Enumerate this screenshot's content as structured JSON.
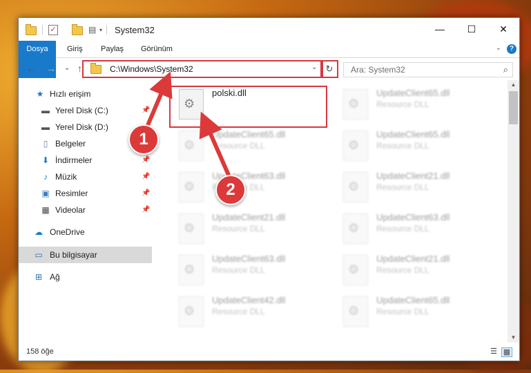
{
  "window": {
    "title": "System32",
    "controls": {
      "minimize": "—",
      "maximize": "☐",
      "close": "✕"
    }
  },
  "ribbon": {
    "tabs": [
      "Dosya",
      "Giriş",
      "Paylaş",
      "Görünüm"
    ],
    "help": "?",
    "collapse": "⌄"
  },
  "navbar": {
    "back": "←",
    "forward": "→",
    "recent": "⌄",
    "up": "↑",
    "address": "C:\\Windows\\System32",
    "refresh": "↻",
    "search_placeholder": "Ara: System32"
  },
  "sidebar": {
    "items": [
      {
        "label": "Hızlı erişim",
        "icon": "star-icon",
        "pinned": false
      },
      {
        "label": "Yerel Disk (C:)",
        "icon": "drive-icon",
        "pinned": true
      },
      {
        "label": "Yerel Disk (D:)",
        "icon": "drive-icon",
        "pinned": true
      },
      {
        "label": "Belgeler",
        "icon": "documents-icon",
        "pinned": true
      },
      {
        "label": "İndirmeler",
        "icon": "downloads-icon",
        "pinned": true
      },
      {
        "label": "Müzik",
        "icon": "music-icon",
        "pinned": true
      },
      {
        "label": "Resimler",
        "icon": "pictures-icon",
        "pinned": true
      },
      {
        "label": "Videolar",
        "icon": "videos-icon",
        "pinned": true
      },
      {
        "label": "OneDrive",
        "icon": "cloud-icon",
        "pinned": false
      },
      {
        "label": "Bu bilgisayar",
        "icon": "computer-icon",
        "pinned": false,
        "selected": true
      },
      {
        "label": "Ağ",
        "icon": "network-icon",
        "pinned": false
      }
    ]
  },
  "files": [
    {
      "name": "polski.dll",
      "type": "",
      "highlighted": true
    },
    {
      "name": "UpdateClient65.dll",
      "type": "Resource DLL"
    },
    {
      "name": "UpdateClient65.dll",
      "type": "Resource DLL"
    },
    {
      "name": "UpdateClient65.dll",
      "type": "Resource DLL"
    },
    {
      "name": "UpdateClient63.dll",
      "type": "Resource DLL"
    },
    {
      "name": "UpdateClient21.dll",
      "type": "Resource DLL"
    },
    {
      "name": "UpdateClient21.dll",
      "type": "Resource DLL"
    },
    {
      "name": "UpdateClient63.dll",
      "type": "Resource DLL"
    },
    {
      "name": "UpdateClient63.dll",
      "type": "Resource DLL"
    },
    {
      "name": "UpdateClient21.dll",
      "type": "Resource DLL"
    },
    {
      "name": "UpdateClient42.dll",
      "type": "Resource DLL"
    },
    {
      "name": "UpdateClient65.dll",
      "type": "Resource DLL"
    }
  ],
  "status": {
    "count": "158 öğe"
  },
  "callouts": [
    "1",
    "2"
  ],
  "colors": {
    "accent": "#1979ca",
    "callout": "#dc3a3a"
  }
}
